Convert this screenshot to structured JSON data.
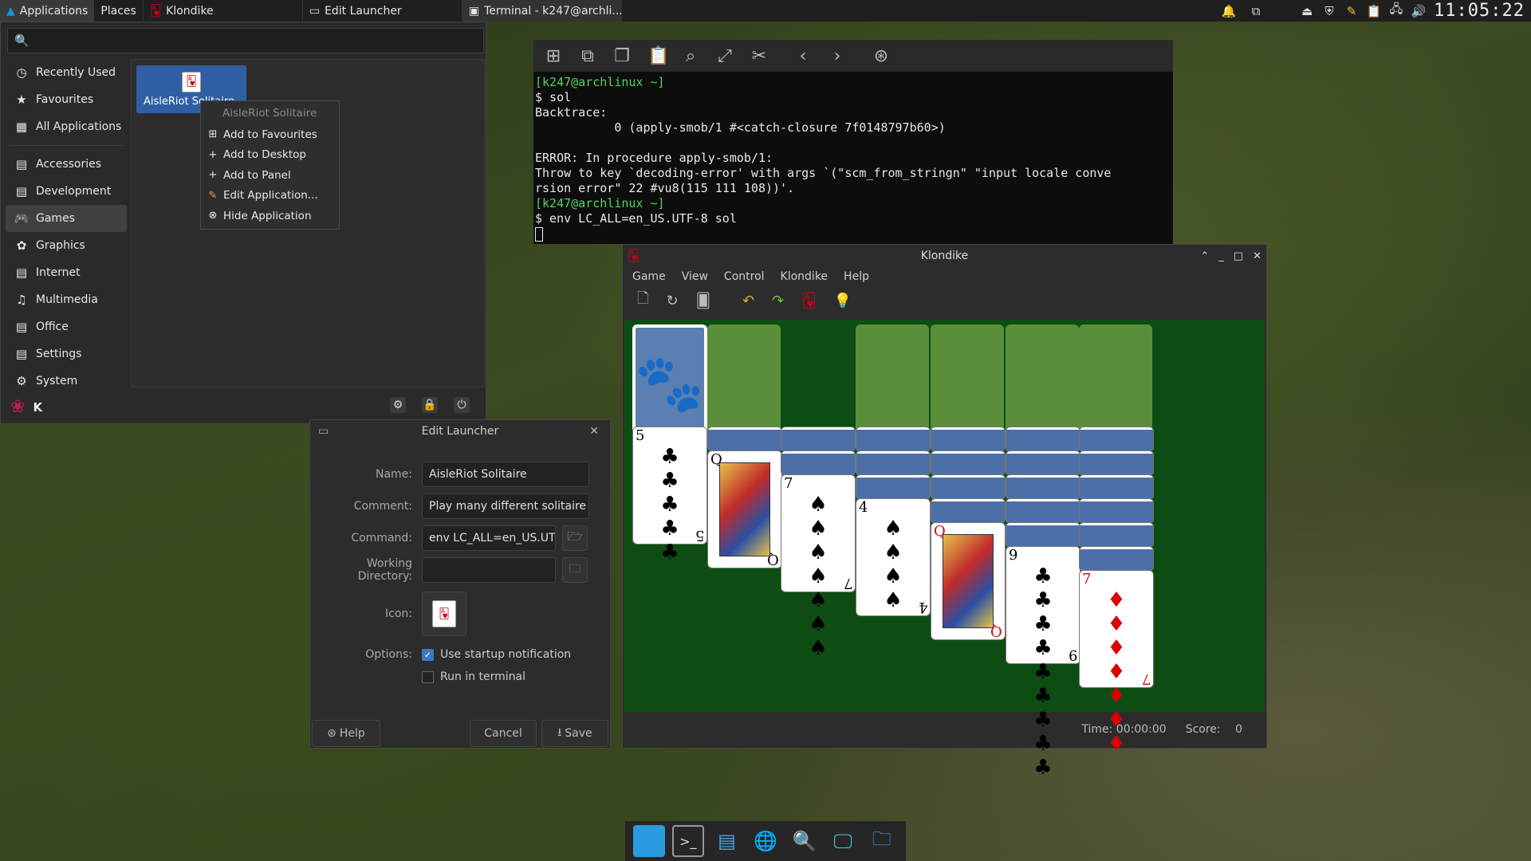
{
  "top_panel": {
    "applications": "Applications",
    "places": "Places",
    "tasks": [
      "Klondike",
      "Edit Launcher",
      "Terminal - k247@archli..."
    ],
    "clock": "11:05:22"
  },
  "app_menu": {
    "categories": [
      {
        "label": "Recently Used",
        "icon": "clock-icon"
      },
      {
        "label": "Favourites",
        "icon": "star-icon"
      },
      {
        "label": "All Applications",
        "icon": "grid-icon"
      },
      {
        "label": "Accessories",
        "icon": "accessories-icon"
      },
      {
        "label": "Development",
        "icon": "development-icon"
      },
      {
        "label": "Games",
        "icon": "gamepad-icon"
      },
      {
        "label": "Graphics",
        "icon": "graphics-icon"
      },
      {
        "label": "Internet",
        "icon": "internet-icon"
      },
      {
        "label": "Multimedia",
        "icon": "multimedia-icon"
      },
      {
        "label": "Office",
        "icon": "office-icon"
      },
      {
        "label": "Settings",
        "icon": "settings-icon"
      },
      {
        "label": "System",
        "icon": "system-icon"
      }
    ],
    "selected_category": "Games",
    "app_item": "AisleRiot Solitaire",
    "user": "K"
  },
  "context_menu": {
    "title": "AisleRiot Solitaire",
    "items": [
      "Add to Favourites",
      "Add to Desktop",
      "Add to Panel",
      "Edit Application...",
      "Hide Application"
    ]
  },
  "terminal": {
    "lines": [
      {
        "text": "[k247@archlinux ~]",
        "green": true
      },
      {
        "text": "$ sol",
        "green": false
      },
      {
        "text": "Backtrace:",
        "green": false
      },
      {
        "text": "           0 (apply-smob/1 #<catch-closure 7f0148797b60>)",
        "green": false
      },
      {
        "text": "",
        "green": false
      },
      {
        "text": "ERROR: In procedure apply-smob/1:",
        "green": false
      },
      {
        "text": "Throw to key `decoding-error' with args `(\"scm_from_stringn\" \"input locale conve",
        "green": false
      },
      {
        "text": "rsion error\" 22 #vu8(115 111 108))'.",
        "green": false
      },
      {
        "text": "[k247@archlinux ~]",
        "green": true
      },
      {
        "text": "$ env LC_ALL=en_US.UTF-8 sol",
        "green": false
      }
    ]
  },
  "klondike": {
    "title": "Klondike",
    "menu": [
      "Game",
      "View",
      "Control",
      "Klondike",
      "Help"
    ],
    "status_time_label": "Time:",
    "status_time": "00:00:00",
    "status_score_label": "Score:",
    "status_score": "0",
    "tableau": [
      {
        "rank": "5",
        "suit": "♣",
        "red": false,
        "hidden": 0
      },
      {
        "rank": "Q",
        "suit": "♣",
        "red": false,
        "hidden": 1
      },
      {
        "rank": "7",
        "suit": "♠",
        "red": false,
        "hidden": 2
      },
      {
        "rank": "4",
        "suit": "♠",
        "red": false,
        "hidden": 3
      },
      {
        "rank": "Q",
        "suit": "♥",
        "red": true,
        "hidden": 4
      },
      {
        "rank": "9",
        "suit": "♣",
        "red": false,
        "hidden": 5
      },
      {
        "rank": "7",
        "suit": "♦",
        "red": true,
        "hidden": 6
      }
    ]
  },
  "edit_launcher": {
    "title": "Edit Launcher",
    "name_label": "Name:",
    "name": "AisleRiot Solitaire",
    "comment_label": "Comment:",
    "comment": "Play many different solitaire",
    "command_label": "Command:",
    "command": "env LC_ALL=en_US.UT",
    "workdir_label": "Working Directory:",
    "workdir": "",
    "icon_label": "Icon:",
    "options_label": "Options:",
    "opt_startup": "Use startup notification",
    "opt_startup_checked": true,
    "opt_terminal": "Run in terminal",
    "opt_terminal_checked": false,
    "help": "Help",
    "cancel": "Cancel",
    "save": "Save"
  }
}
